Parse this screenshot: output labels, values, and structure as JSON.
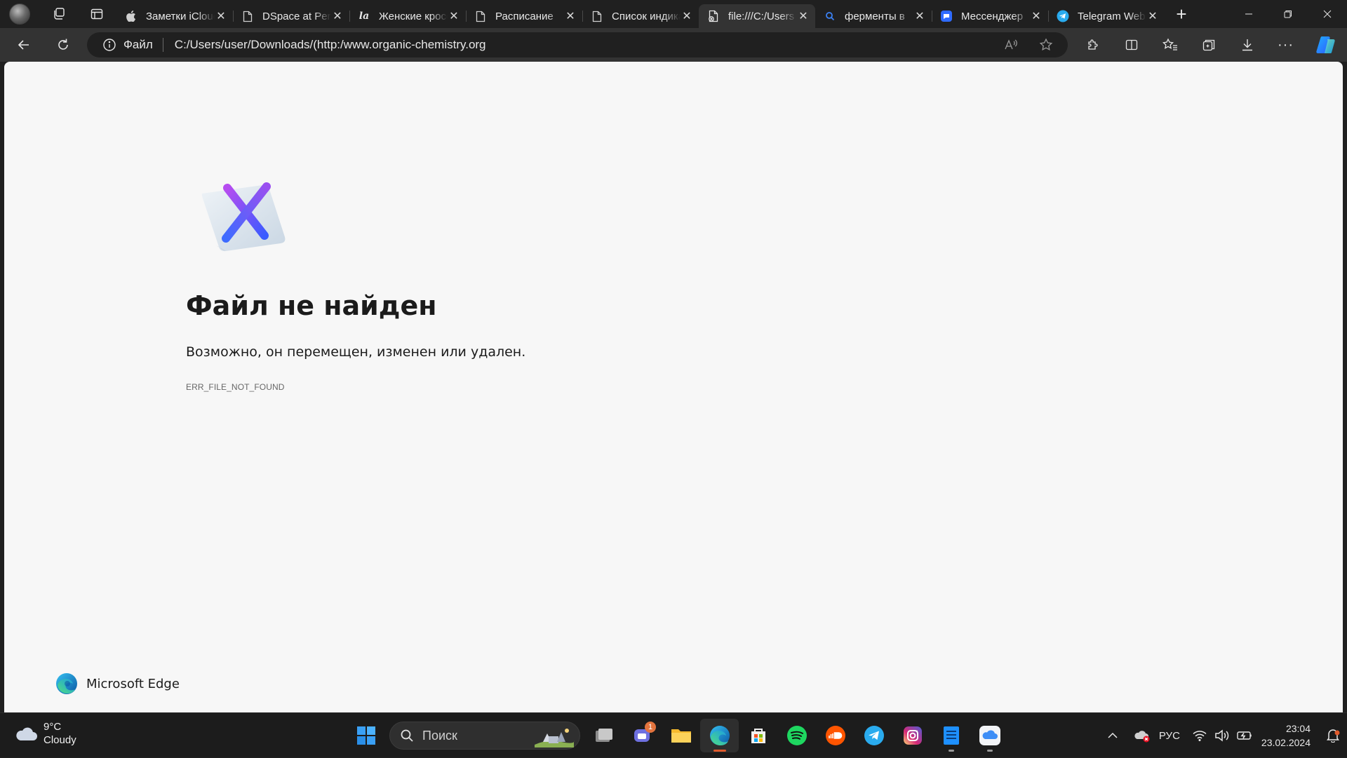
{
  "browser": {
    "tabs": [
      {
        "title": "Заметки iCloud",
        "favicon": "apple-icon"
      },
      {
        "title": "DSpace at Perm",
        "favicon": "page-icon"
      },
      {
        "title": "Женские кроссовки",
        "favicon": "la-icon"
      },
      {
        "title": "Расписание",
        "favicon": "page-icon"
      },
      {
        "title": "Список индикаторов",
        "favicon": "page-icon"
      },
      {
        "title": "file:///C:/Users",
        "favicon": "broken-file-icon",
        "active": true
      },
      {
        "title": "ферменты в",
        "favicon": "search-icon"
      },
      {
        "title": "Мессенджер",
        "favicon": "chat-icon"
      },
      {
        "title": "Telegram Web",
        "favicon": "telegram-icon"
      }
    ],
    "address": {
      "scheme_label": "Файл",
      "url": "C:/Users/user/Downloads/(http:/www.organic-chemistry.org"
    },
    "colors": {
      "chrome_dark": "#202020",
      "toolbar": "#333333",
      "page_bg": "#f7f7f7",
      "accent": "#e05a2c"
    }
  },
  "page": {
    "heading": "Файл не найден",
    "description": "Возможно, он перемещен, изменен или удален.",
    "error_code": "ERR_FILE_NOT_FOUND",
    "brand": "Microsoft Edge"
  },
  "taskbar": {
    "weather": {
      "temp": "9°C",
      "condition": "Cloudy"
    },
    "search_placeholder": "Поиск",
    "apps": [
      "task-view",
      "teams",
      "file-explorer",
      "edge",
      "microsoft-store",
      "spotify",
      "soundcloud",
      "telegram",
      "instagram",
      "notes",
      "icloud"
    ],
    "teams_badge": "1",
    "language": "РУС",
    "time": "23:04",
    "date": "23.02.2024"
  }
}
